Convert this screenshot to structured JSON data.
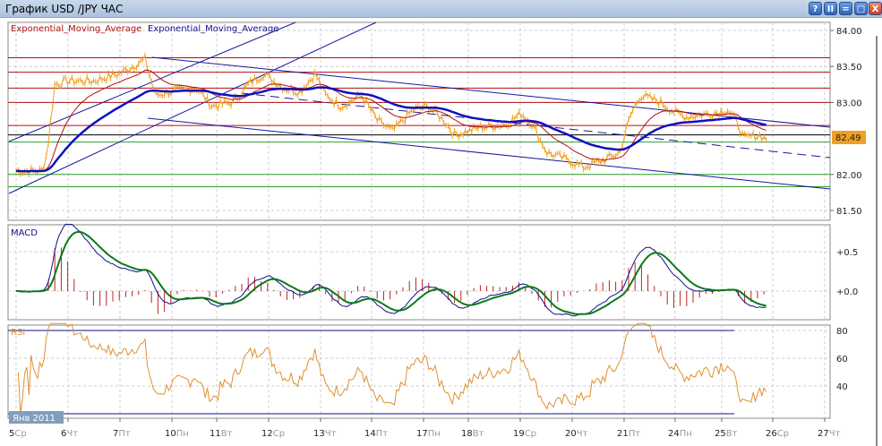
{
  "window": {
    "title": "График USD /JPY  ЧАС",
    "buttons": [
      "?",
      "II",
      "=",
      "□",
      "X"
    ]
  },
  "legend": {
    "ema_fast": "Exponential_Moving_Average",
    "ema_slow": "Exponential_Moving_Average",
    "macd": "MACD",
    "rsi": "RSI"
  },
  "colors": {
    "price": "#f0a020",
    "ema_fast": "#b01010",
    "ema_slow": "#1010c0",
    "macd": "#10108a",
    "signal": "#0a7a1a",
    "hist": "#c02020",
    "rsi": "#e09030"
  },
  "current_price": "82.49",
  "month_label": "Янв 2011",
  "chart_data": [
    {
      "type": "line",
      "title": "USD/JPY ЧАС",
      "yticks": [
        "84.00",
        "83.50",
        "83.00",
        "82.00",
        "81.50"
      ],
      "ylim": [
        81.45,
        84.15
      ],
      "xticks": [
        {
          "d": "5",
          "w": "Ср"
        },
        {
          "d": "6",
          "w": "Чт"
        },
        {
          "d": "7",
          "w": "Пт"
        },
        {
          "d": "10",
          "w": "Пн"
        },
        {
          "d": "11",
          "w": "Вт"
        },
        {
          "d": "12",
          "w": "Ср"
        },
        {
          "d": "13",
          "w": "Чт"
        },
        {
          "d": "14",
          "w": "Пт"
        },
        {
          "d": "17",
          "w": "Пн"
        },
        {
          "d": "18",
          "w": "Вт"
        },
        {
          "d": "19",
          "w": "Ср"
        },
        {
          "d": "20",
          "w": "Чт"
        },
        {
          "d": "21",
          "w": "Пт"
        },
        {
          "d": "24",
          "w": "Пн"
        },
        {
          "d": "25",
          "w": "Вт"
        },
        {
          "d": "26",
          "w": "Ср"
        },
        {
          "d": "27",
          "w": "Чт"
        }
      ],
      "price_waypoints": [
        [
          0,
          82.05
        ],
        [
          0.5,
          82.05
        ],
        [
          0.6,
          82.3
        ],
        [
          0.75,
          83.25
        ],
        [
          1,
          83.3
        ],
        [
          1.5,
          83.3
        ],
        [
          2,
          83.4
        ],
        [
          2.5,
          83.6
        ],
        [
          2.7,
          83.1
        ],
        [
          3,
          83.15
        ],
        [
          3.5,
          83.2
        ],
        [
          3.8,
          82.95
        ],
        [
          4.2,
          83.0
        ],
        [
          4.5,
          83.25
        ],
        [
          4.8,
          83.4
        ],
        [
          5.2,
          83.2
        ],
        [
          5.5,
          83.15
        ],
        [
          5.8,
          83.4
        ],
        [
          6,
          83.1
        ],
        [
          6.3,
          82.95
        ],
        [
          6.7,
          83.1
        ],
        [
          7,
          82.75
        ],
        [
          7.3,
          82.6
        ],
        [
          7.7,
          82.9
        ],
        [
          8,
          82.95
        ],
        [
          8.3,
          82.75
        ],
        [
          8.5,
          82.55
        ],
        [
          9,
          82.65
        ],
        [
          9.5,
          82.7
        ],
        [
          9.8,
          82.85
        ],
        [
          10,
          82.7
        ],
        [
          10.3,
          82.3
        ],
        [
          10.7,
          82.2
        ],
        [
          11,
          82.1
        ],
        [
          11.4,
          82.2
        ],
        [
          11.7,
          82.3
        ],
        [
          11.9,
          82.8
        ],
        [
          12.1,
          83.1
        ],
        [
          12.5,
          83.0
        ],
        [
          12.8,
          82.85
        ],
        [
          13,
          82.8
        ],
        [
          13.5,
          82.85
        ],
        [
          13.8,
          82.9
        ],
        [
          14,
          82.7
        ],
        [
          14.1,
          82.5
        ],
        [
          14.4,
          82.55
        ],
        [
          14.55,
          82.49
        ]
      ],
      "hlines_red": [
        83.62,
        83.42,
        83.2,
        83.0,
        82.68
      ],
      "hline_black": 82.55,
      "hlines_green": [
        82.45,
        82.0,
        81.83
      ]
    },
    {
      "type": "line",
      "title": "MACD",
      "yticks": [
        "+0.5",
        "+0.0"
      ],
      "ylim": [
        -0.4,
        0.85
      ]
    },
    {
      "type": "line",
      "title": "RSI",
      "yticks": [
        "80",
        "60",
        "40"
      ],
      "ylim": [
        15,
        85
      ],
      "levels": [
        80,
        20
      ]
    }
  ]
}
